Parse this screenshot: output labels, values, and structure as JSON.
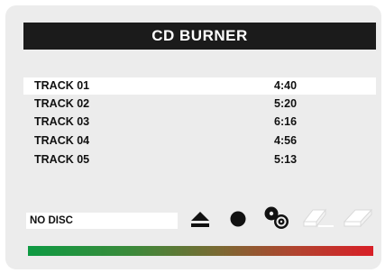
{
  "title": "CD BURNER",
  "tracks": [
    {
      "name": "TRACK 01",
      "duration": "4:40",
      "selected": true
    },
    {
      "name": "TRACK 02",
      "duration": "5:20",
      "selected": false
    },
    {
      "name": "TRACK 03",
      "duration": "6:16",
      "selected": false
    },
    {
      "name": "TRACK 04",
      "duration": "4:56",
      "selected": false
    },
    {
      "name": "TRACK 05",
      "duration": "5:13",
      "selected": false
    }
  ],
  "status": "NO DISC",
  "controls": [
    {
      "icon": "eject-icon",
      "enabled": true
    },
    {
      "icon": "record-icon",
      "enabled": true
    },
    {
      "icon": "burn-disc-icon",
      "enabled": true
    },
    {
      "icon": "erase-icon",
      "enabled": false
    },
    {
      "icon": "eraser-icon",
      "enabled": false
    }
  ],
  "colors": {
    "title_bg": "#1b1b1b",
    "panel_bg": "#ececec",
    "progress_start": "#0e9a43",
    "progress_end": "#d81f27",
    "disabled_icon": "#ffffff"
  }
}
